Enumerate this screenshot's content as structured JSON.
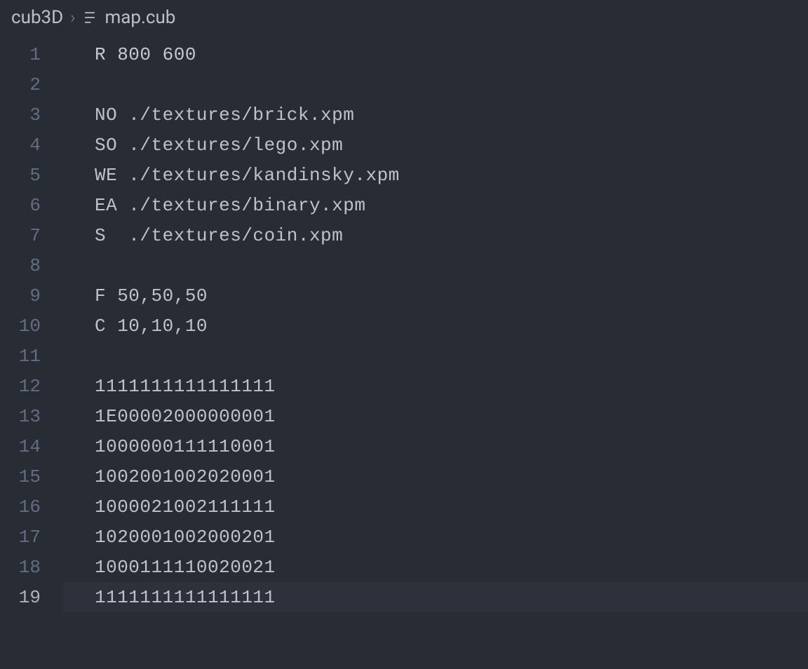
{
  "breadcrumb": {
    "folder": "cub3D",
    "separator": "›",
    "file": "map.cub"
  },
  "lines": [
    {
      "num": "1",
      "text": "R 800 600"
    },
    {
      "num": "2",
      "text": ""
    },
    {
      "num": "3",
      "text": "NO ./textures/brick.xpm"
    },
    {
      "num": "4",
      "text": "SO ./textures/lego.xpm"
    },
    {
      "num": "5",
      "text": "WE ./textures/kandinsky.xpm"
    },
    {
      "num": "6",
      "text": "EA ./textures/binary.xpm"
    },
    {
      "num": "7",
      "text": "S  ./textures/coin.xpm"
    },
    {
      "num": "8",
      "text": ""
    },
    {
      "num": "9",
      "text": "F 50,50,50"
    },
    {
      "num": "10",
      "text": "C 10,10,10"
    },
    {
      "num": "11",
      "text": ""
    },
    {
      "num": "12",
      "text": "1111111111111111"
    },
    {
      "num": "13",
      "text": "1E00002000000001"
    },
    {
      "num": "14",
      "text": "1000000111110001"
    },
    {
      "num": "15",
      "text": "1002001002020001"
    },
    {
      "num": "16",
      "text": "1000021002111111"
    },
    {
      "num": "17",
      "text": "1020001002000201"
    },
    {
      "num": "18",
      "text": "1000111110020021"
    },
    {
      "num": "19",
      "text": "1111111111111111"
    }
  ],
  "currentLine": 19
}
